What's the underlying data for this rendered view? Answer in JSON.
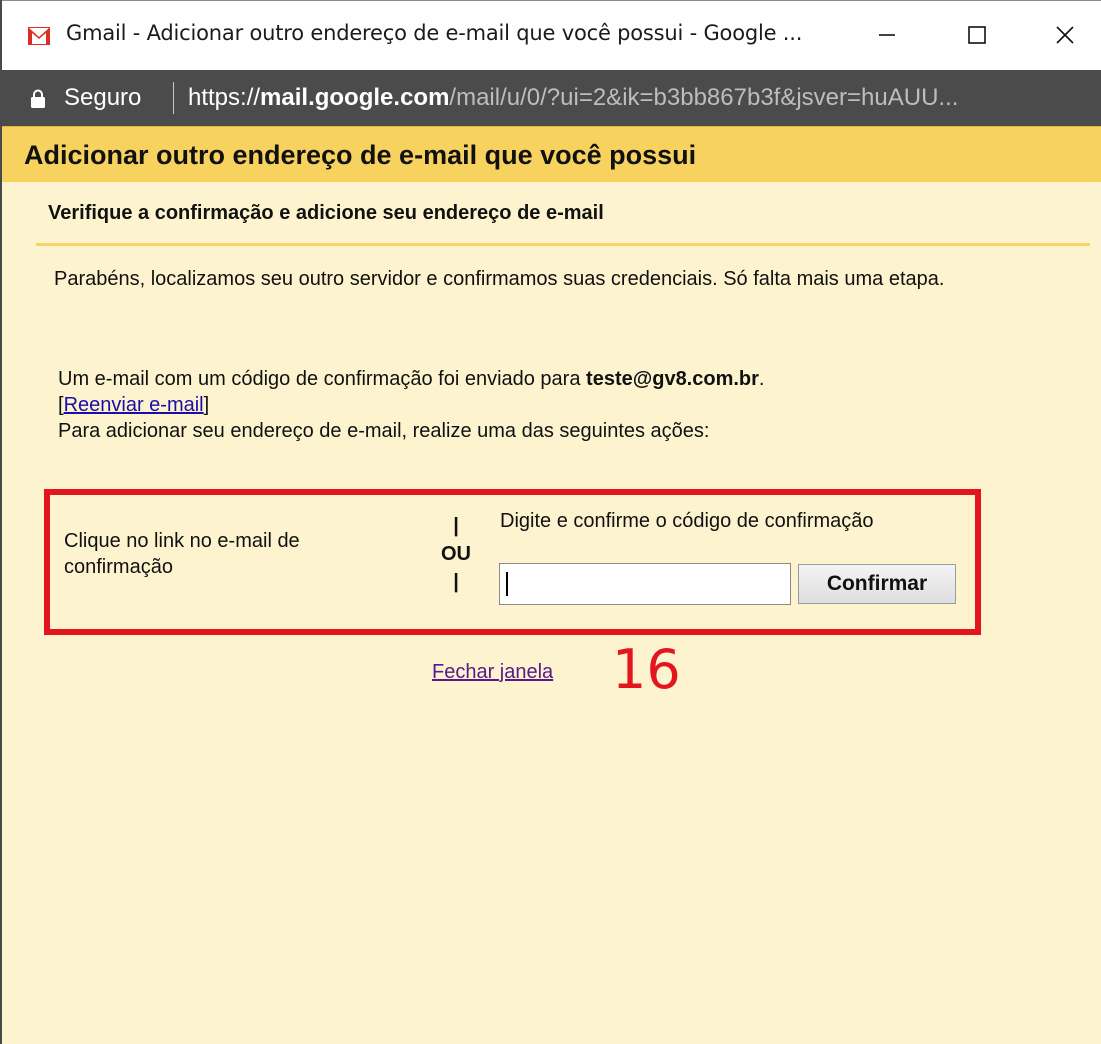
{
  "window": {
    "title": "Gmail - Adicionar outro endereço de e-mail que você possui - Google ...",
    "controls": {
      "minimize": "—",
      "maximize": "☐",
      "close": "✕"
    }
  },
  "addressbar": {
    "secure_label": "Seguro",
    "url_protocol": "https://",
    "url_host": "mail.google.com",
    "url_path": "/mail/u/0/?ui=2&ik=b3bb867b3f&jsver=huAUU..."
  },
  "dialog": {
    "header_title": "Adicionar outro endereço de e-mail que você possui",
    "subtitle": "Verifique a confirmação e adicione seu endereço de e-mail",
    "congrats_text": "Parabéns, localizamos seu outro servidor e confirmamos suas credenciais. Só falta mais uma etapa.",
    "sent_prefix": "Um e-mail com um código de confirmação foi enviado para ",
    "sent_email": "teste@gv8.com.br",
    "sent_suffix": ".",
    "bracket_open": "[",
    "resend_link": "Reenviar e-mail",
    "bracket_close": "]",
    "instruction": "Para adicionar seu endereço de e-mail, realize uma das seguintes ações:",
    "option_left": "Clique no link no e-mail de confirmação",
    "separator_top": "|",
    "separator_word": "OU",
    "separator_bottom": "|",
    "option_right": "Digite e confirme o código de confirmação",
    "code_input_value": "",
    "confirm_button": "Confirmar",
    "close_link": "Fechar janela"
  },
  "annotation": {
    "number": "16",
    "color": "#e3151f"
  },
  "colors": {
    "header_bg": "#f8d25e",
    "content_bg": "#fdf4cf",
    "addressbar_bg": "#4b4b4b",
    "highlight_border": "#e3151f"
  }
}
